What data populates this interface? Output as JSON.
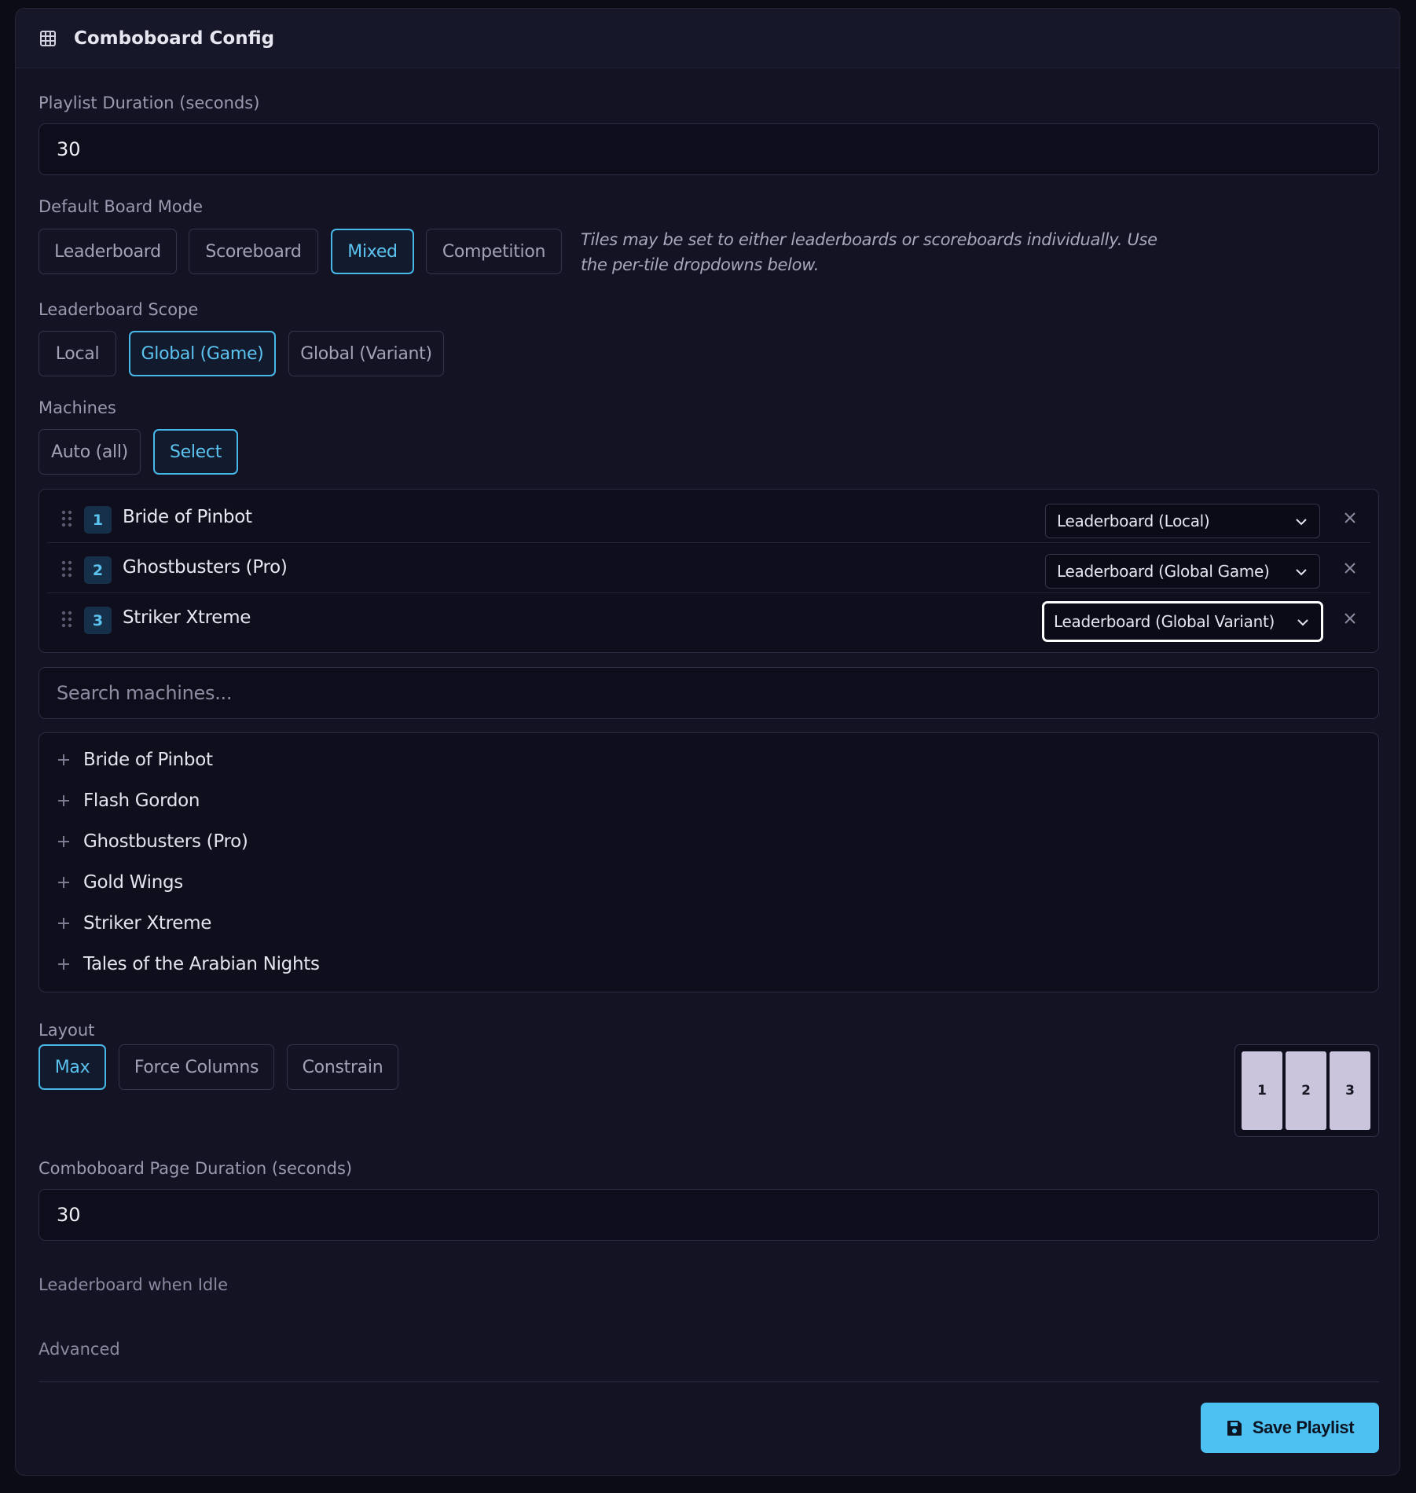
{
  "header": {
    "title": "Comboboard Config",
    "icon": "grid-icon"
  },
  "playlist_duration": {
    "label": "Playlist Duration (seconds)",
    "value": "30"
  },
  "board_mode": {
    "label": "Default Board Mode",
    "options": [
      "Leaderboard",
      "Scoreboard",
      "Mixed",
      "Competition"
    ],
    "selected": "Mixed",
    "hint_line1": "Tiles may be set to either leaderboards or scoreboards individually. Use",
    "hint_line2": "the per-tile dropdowns below."
  },
  "scope": {
    "label": "Leaderboard Scope",
    "options": [
      "Local",
      "Global (Game)",
      "Global (Variant)"
    ],
    "selected": "Global (Game)"
  },
  "machines": {
    "label": "Machines",
    "options": [
      "Auto (all)",
      "Select"
    ],
    "selected": "Select",
    "selected_list": [
      {
        "index": "1",
        "name": "Bride of Pinbot",
        "mode": "Leaderboard (Local)"
      },
      {
        "index": "2",
        "name": "Ghostbusters (Pro)",
        "mode": "Leaderboard (Global Game)"
      },
      {
        "index": "3",
        "name": "Striker Xtreme",
        "mode": "Leaderboard (Global Variant)"
      }
    ],
    "search_placeholder": "Search machines...",
    "available": [
      "Bride of Pinbot",
      "Flash Gordon",
      "Ghostbusters (Pro)",
      "Gold Wings",
      "Striker Xtreme",
      "Tales of the Arabian Nights"
    ]
  },
  "layout": {
    "label": "Layout",
    "options": [
      "Max",
      "Force Columns",
      "Constrain"
    ],
    "selected": "Max",
    "preview_tiles": [
      "1",
      "2",
      "3"
    ]
  },
  "page_duration": {
    "label": "Comboboard Page Duration (seconds)",
    "value": "30"
  },
  "sections": {
    "idle": "Leaderboard when Idle",
    "advanced": "Advanced"
  },
  "footer": {
    "save_label": "Save Playlist"
  },
  "colors": {
    "accent": "#4cc1f2",
    "background": "#0c0c17",
    "panel": "#131324"
  }
}
